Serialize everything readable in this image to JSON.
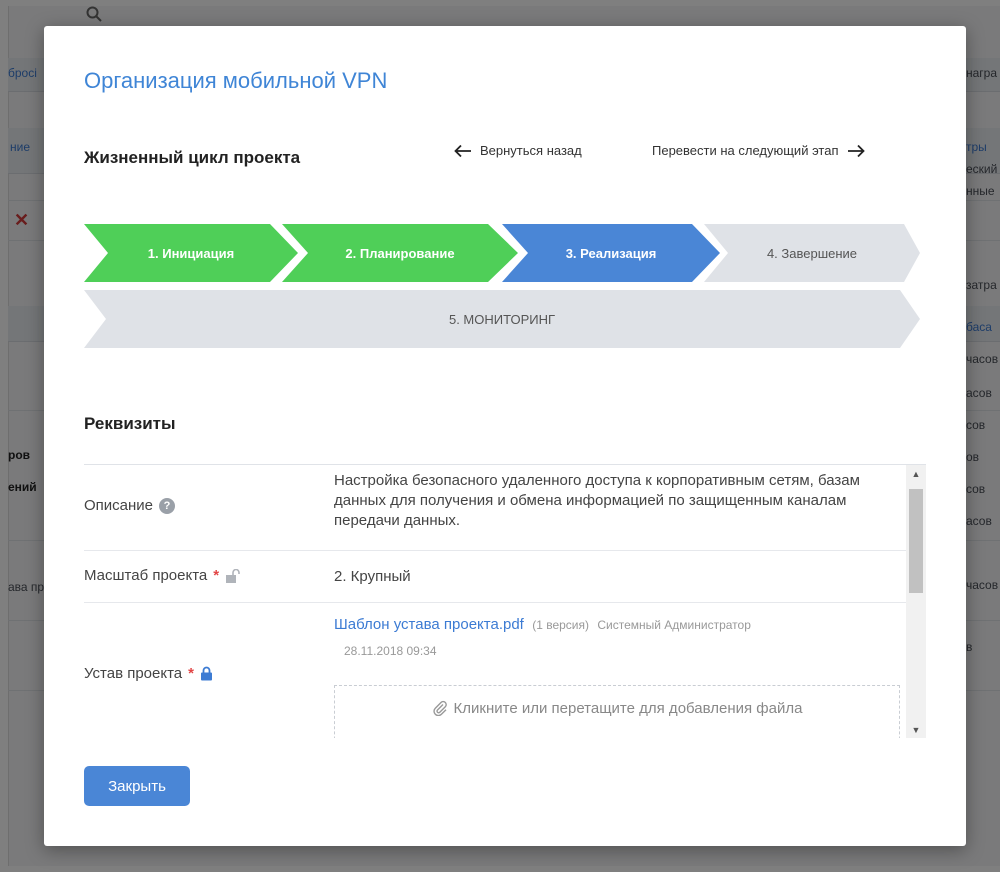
{
  "background": {
    "left_items": [
      "бросі",
      "ние",
      "ров",
      "ений",
      "ава пр"
    ],
    "right_items": [
      "награ",
      "тры",
      "еский",
      "нные",
      "затра",
      "баса",
      "часов",
      "асов",
      "сов",
      "ов",
      "сов",
      "асов",
      "часов",
      "в"
    ]
  },
  "modal": {
    "title": "Организация мобильной VPN",
    "lifecycle_title": "Жизненный цикл проекта",
    "back_label": "Вернуться назад",
    "next_label": "Перевести на следующий этап",
    "steps": [
      {
        "label": "1. Инициация",
        "state": "done",
        "color": "#4fcf58"
      },
      {
        "label": "2. Планирование",
        "state": "done",
        "color": "#4fcf58"
      },
      {
        "label": "3. Реализация",
        "state": "current",
        "color": "#4a86d6"
      },
      {
        "label": "4. Завершение",
        "state": "pending",
        "color": "#dfe2e7"
      },
      {
        "label": "5. МОНИТОРИНГ",
        "state": "pending",
        "color": "#dfe2e7"
      }
    ],
    "requisites_title": "Реквизиты",
    "fields": {
      "description": {
        "label": "Описание",
        "value": "Настройка безопасного удаленного доступа к корпоративным сетям, базам данных для получения и обмена информацией по защищенным каналам передачи данных."
      },
      "scale": {
        "label": "Масштаб проекта",
        "required_mark": "*",
        "value": "2. Крупный",
        "icon": "lock-open-icon"
      },
      "charter": {
        "label": "Устав проекта",
        "required_mark": "*",
        "icon": "lock-icon",
        "file_name": "Шаблон устава проекта.pdf",
        "file_version": "(1 версия)",
        "file_author": "Системный Администратор",
        "file_date": "28.11.2018 09:34",
        "dropzone_text": "Кликните или перетащите для добавления файла"
      }
    },
    "close_label": "Закрыть"
  }
}
